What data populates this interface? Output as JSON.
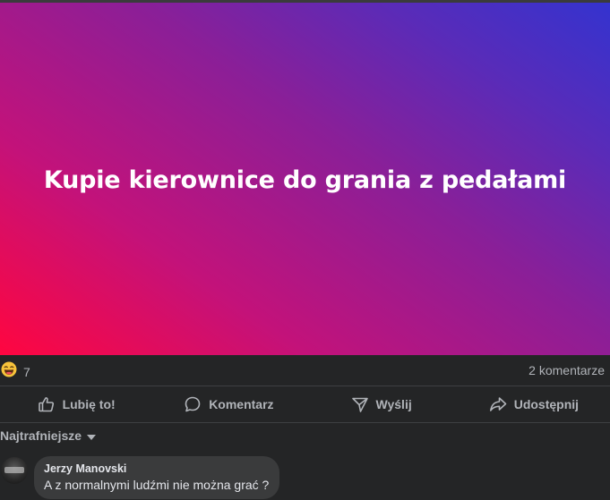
{
  "post": {
    "text": "Kupie kierownice do grania z pedałami"
  },
  "stats": {
    "reaction_icon": "laughing-emoji-icon",
    "reaction_count": "7",
    "comments_label": "2 komentarze"
  },
  "actions": {
    "like": "Lubię to!",
    "comment": "Komentarz",
    "send": "Wyślij",
    "share": "Udostępnij"
  },
  "sort": {
    "label": "Najtrafniejsze"
  },
  "comments": [
    {
      "author": "Jerzy Manovski",
      "text": "A z normalnymi ludźmi nie można grać ?"
    }
  ]
}
